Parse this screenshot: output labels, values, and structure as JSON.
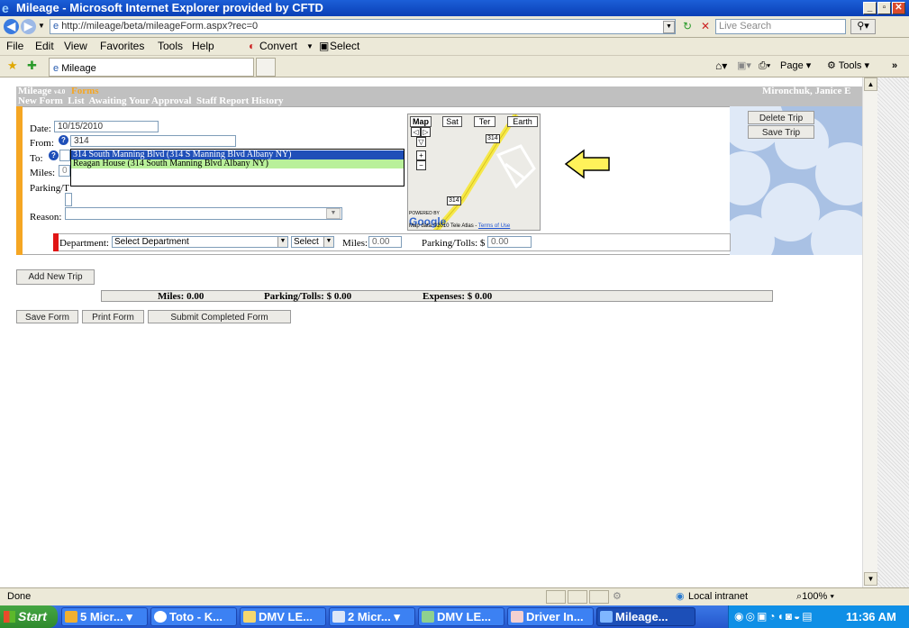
{
  "window": {
    "title": "Mileage - Microsoft Internet Explorer provided by CFTD"
  },
  "address": {
    "url": "http://mileage/beta/mileageForm.aspx?rec=0",
    "search_placeholder": "Live Search"
  },
  "menu": {
    "items": [
      "File",
      "Edit",
      "View",
      "Favorites",
      "Tools",
      "Help"
    ],
    "convert": "Convert",
    "select": "Select"
  },
  "tab": {
    "label": "Mileage",
    "page": "Page",
    "tools": "Tools",
    "more": "»"
  },
  "app": {
    "title": "Mileage",
    "version": "v4.0",
    "section": "Forms",
    "nav": [
      "New Form",
      "List",
      "Awaiting Your Approval",
      "Staff Report History"
    ],
    "user": "Mironchuk, Janice E"
  },
  "form": {
    "date_label": "Date:",
    "date_value": "10/15/2010",
    "from_label": "From:",
    "from_value": "314",
    "to_label": "To:",
    "miles_label": "Miles:",
    "miles_value": "0",
    "parking_label": "Parking/T",
    "reason_label": "Reason:",
    "delete_trip": "Delete Trip",
    "save_trip": "Save Trip",
    "department_label": "Department:",
    "department_value": "Select Department",
    "select_value": "Select",
    "row_miles_label": "Miles:",
    "row_miles_value": "0.00",
    "row_parking_label": "Parking/Tolls: $",
    "row_parking_value": "0.00",
    "suggestions": [
      "314 South Manning Blvd (314 S Manning Blvd Albany NY)",
      "Reagan House (314 South Manning Blvd Albany NY)"
    ]
  },
  "map": {
    "tabs": [
      "Map",
      "Sat",
      "Ter",
      "Earth"
    ],
    "route": "314",
    "powered_by": "POWERED BY",
    "logo": "Google",
    "attribution": "Map data ©2010 Tele Atlas - ",
    "terms": "Terms of Use"
  },
  "actions": {
    "add_trip": "Add New Trip",
    "save_form": "Save Form",
    "print_form": "Print Form",
    "submit_form": "Submit Completed Form"
  },
  "totals": {
    "miles": "Miles: 0.00",
    "parking": "Parking/Tolls: $ 0.00",
    "expenses": "Expenses: $ 0.00"
  },
  "status": {
    "text": "Done",
    "zone": "Local intranet",
    "zoom": "100%"
  },
  "taskbar": {
    "start": "Start",
    "items": [
      "5 Micr...",
      "Toto - K...",
      "DMV LE...",
      "2 Micr...",
      "DMV LE...",
      "Driver In...",
      "Mileage..."
    ],
    "clock": "11:36 AM"
  }
}
